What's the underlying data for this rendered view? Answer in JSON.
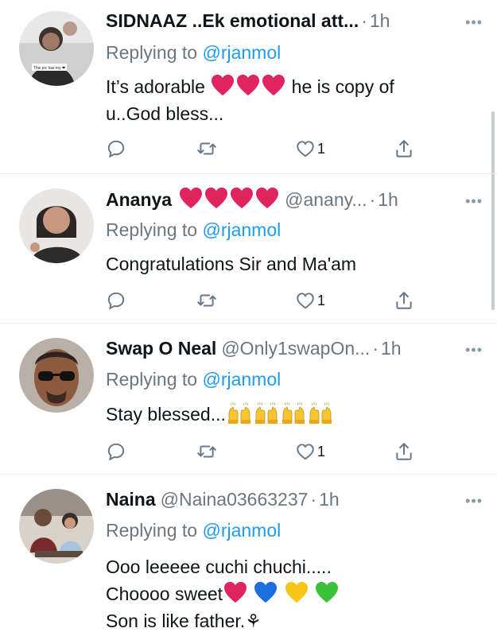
{
  "tweets": [
    {
      "name": "SIDNAAZ ..Ek emotional att...",
      "handle": "",
      "dot": "·",
      "time": "1h",
      "more": "•••",
      "reply_prefix": "Replying to",
      "reply_to": "@rjanmol",
      "body_line1_a": "It’s adorable",
      "body_line1_b": "he is copy of",
      "body_line2": "u..God bless...",
      "like_count": "1",
      "avatar_caption": "This pic has my ❤"
    },
    {
      "name": "Ananya",
      "handle": "@anany...",
      "dot": "·",
      "time": "1h",
      "more": "•••",
      "reply_prefix": "Replying to",
      "reply_to": "@rjanmol",
      "body_line1": "Congratulations Sir and Ma'am",
      "like_count": "1"
    },
    {
      "name": "Swap O Neal",
      "handle": "@Only1swapOn...",
      "dot": "·",
      "time": "1h",
      "more": "•••",
      "reply_prefix": "Replying to",
      "reply_to": "@rjanmol",
      "body_line1": "Stay blessed...",
      "like_count": "1"
    },
    {
      "name": "Naina",
      "handle": "@Naina03663237",
      "dot": "·",
      "time": "1h",
      "more": "•••",
      "reply_prefix": "Replying to",
      "reply_to": "@rjanmol",
      "body_line1": "Ooo leeeee cuchi chuchi.....",
      "body_line2": "Choooo sweet",
      "body_line3": "Son is like father.",
      "body_line3_emoji": "⚘"
    }
  ],
  "colors": {
    "accent": "#1d9bf0",
    "muted": "#6a7781",
    "heart_red": "#e0245e",
    "heart_blue": "#1d6fe0",
    "heart_yellow": "#f5c518",
    "heart_green": "#3cc13b"
  },
  "icons": [
    "reply-icon",
    "retweet-icon",
    "like-icon",
    "share-icon",
    "more-icon"
  ]
}
